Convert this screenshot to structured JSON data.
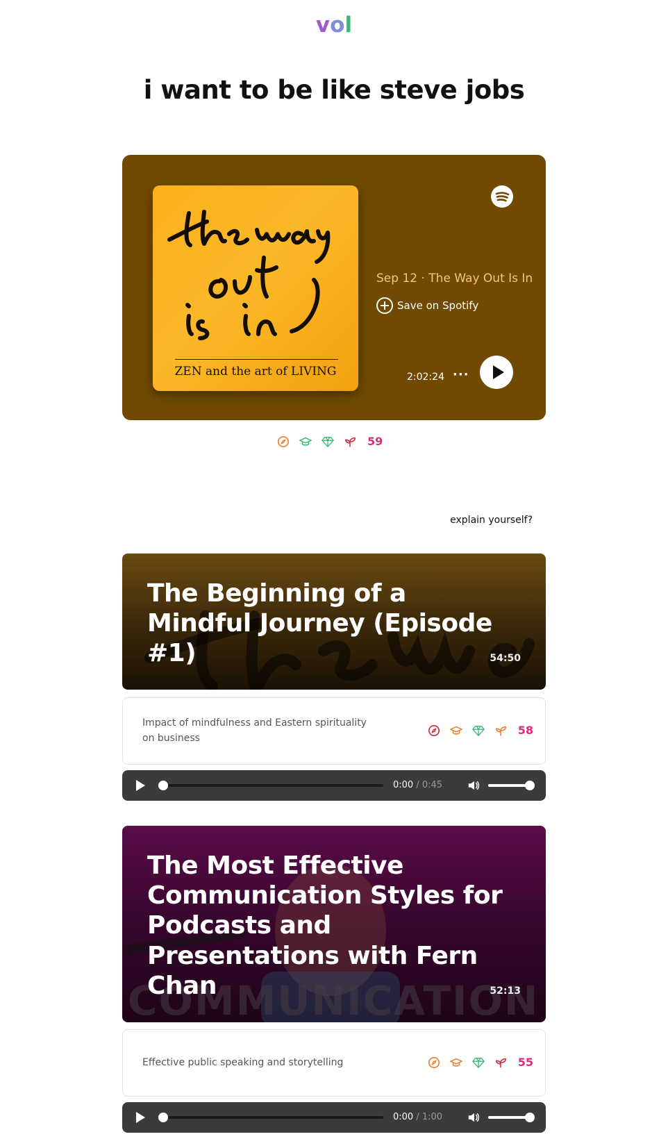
{
  "app": {
    "logo_v": "v",
    "logo_o": "o",
    "logo_l": "l"
  },
  "page": {
    "title": "i want to be like steve jobs"
  },
  "featured": {
    "cover_title": "the way out is in",
    "cover_subtitle": "ZEN and the art of LIVING",
    "episode_meta": "Sep 12 · The Way Out Is In",
    "save_label": "Save on Spotify",
    "duration": "2:02:24",
    "more_label": "···",
    "score": "59",
    "icons": [
      "compass-icon",
      "graduation-cap-icon",
      "gem-icon",
      "sprout-icon"
    ],
    "icon_colors": [
      "#f07c2a",
      "#3cb878",
      "#3cb878",
      "#d0283a"
    ]
  },
  "explain_link": "explain yourself?",
  "episodes": [
    {
      "title": "The Beginning of a Mindful Journey (Episode #1)",
      "duration": "54:50",
      "description": "Impact of mindfulness and Eastern spirituality on business",
      "score": "58",
      "icon_colors": [
        "#d0283a",
        "#f07c2a",
        "#3cb878",
        "#f07c2a"
      ],
      "audio": {
        "current": "0:00",
        "separator": "/",
        "total": "0:45"
      }
    },
    {
      "title": "The Most Effective Communication Styles for Podcasts and Presentations with Fern Chan",
      "duration": "52:13",
      "bg_word": "COMMUNICATION",
      "description": "Effective public speaking and storytelling",
      "score": "55",
      "icon_colors": [
        "#f07c2a",
        "#f07c2a",
        "#3cb878",
        "#d0283a"
      ],
      "audio": {
        "current": "0:00",
        "separator": "/",
        "total": "1:00"
      }
    }
  ],
  "colors": {
    "spotify_bg": "#6f4a00",
    "score": "#e5287a",
    "audio_bg": "#3b3b3b"
  }
}
